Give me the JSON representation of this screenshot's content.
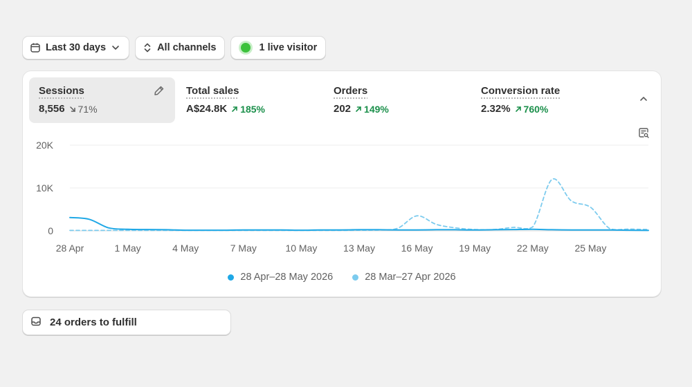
{
  "filters": {
    "date_range_label": "Last 30 days",
    "channels_label": "All channels",
    "live_visitors_label": "1 live visitor"
  },
  "metrics": [
    {
      "label": "Sessions",
      "value": "8,556",
      "delta": "71%",
      "direction": "down",
      "selected": true
    },
    {
      "label": "Total sales",
      "value": "A$24.8K",
      "delta": "185%",
      "direction": "up"
    },
    {
      "label": "Orders",
      "value": "202",
      "delta": "149%",
      "direction": "up"
    },
    {
      "label": "Conversion rate",
      "value": "2.32%",
      "delta": "760%",
      "direction": "up"
    }
  ],
  "colors": {
    "current_series": "#1fa8e6",
    "previous_series": "#7ccbee",
    "positive_delta": "#1a8f4a",
    "live_dot": "#3cc23c"
  },
  "icons": {
    "date": "calendar-icon",
    "channels": "up-down-chevrons-icon",
    "edit": "pencil-icon",
    "collapse": "chevron-up-icon",
    "explore": "report-search-icon",
    "fulfill": "inbox-icon"
  },
  "chart_data": {
    "type": "line",
    "metric": "Sessions",
    "ylim": [
      0,
      20000
    ],
    "y_ticks": [
      0,
      10000,
      20000
    ],
    "y_tick_labels": [
      "0",
      "10K",
      "20K"
    ],
    "x_tick_labels": [
      "28 Apr",
      "1 May",
      "4 May",
      "7 May",
      "10 May",
      "13 May",
      "16 May",
      "19 May",
      "22 May",
      "25 May"
    ],
    "x_tick_day_index": [
      0,
      3,
      6,
      9,
      12,
      15,
      18,
      21,
      24,
      27
    ],
    "days": 31,
    "grid": true,
    "legend_position": "bottom",
    "series": [
      {
        "name": "28 Apr–28 May 2026",
        "style": "solid",
        "values": [
          3100,
          2700,
          700,
          350,
          300,
          250,
          150,
          150,
          150,
          200,
          200,
          200,
          150,
          200,
          200,
          250,
          250,
          200,
          200,
          250,
          250,
          200,
          250,
          300,
          350,
          250,
          200,
          200,
          200,
          150,
          100
        ]
      },
      {
        "name": "28 Mar–27 Apr 2026",
        "style": "dashed",
        "values": [
          100,
          100,
          100,
          100,
          100,
          100,
          100,
          100,
          100,
          100,
          100,
          100,
          100,
          100,
          100,
          150,
          200,
          600,
          3500,
          1500,
          700,
          300,
          300,
          800,
          900,
          12000,
          7000,
          5500,
          500,
          400,
          300
        ]
      }
    ]
  },
  "fulfill": {
    "label": "24 orders to fulfill"
  }
}
